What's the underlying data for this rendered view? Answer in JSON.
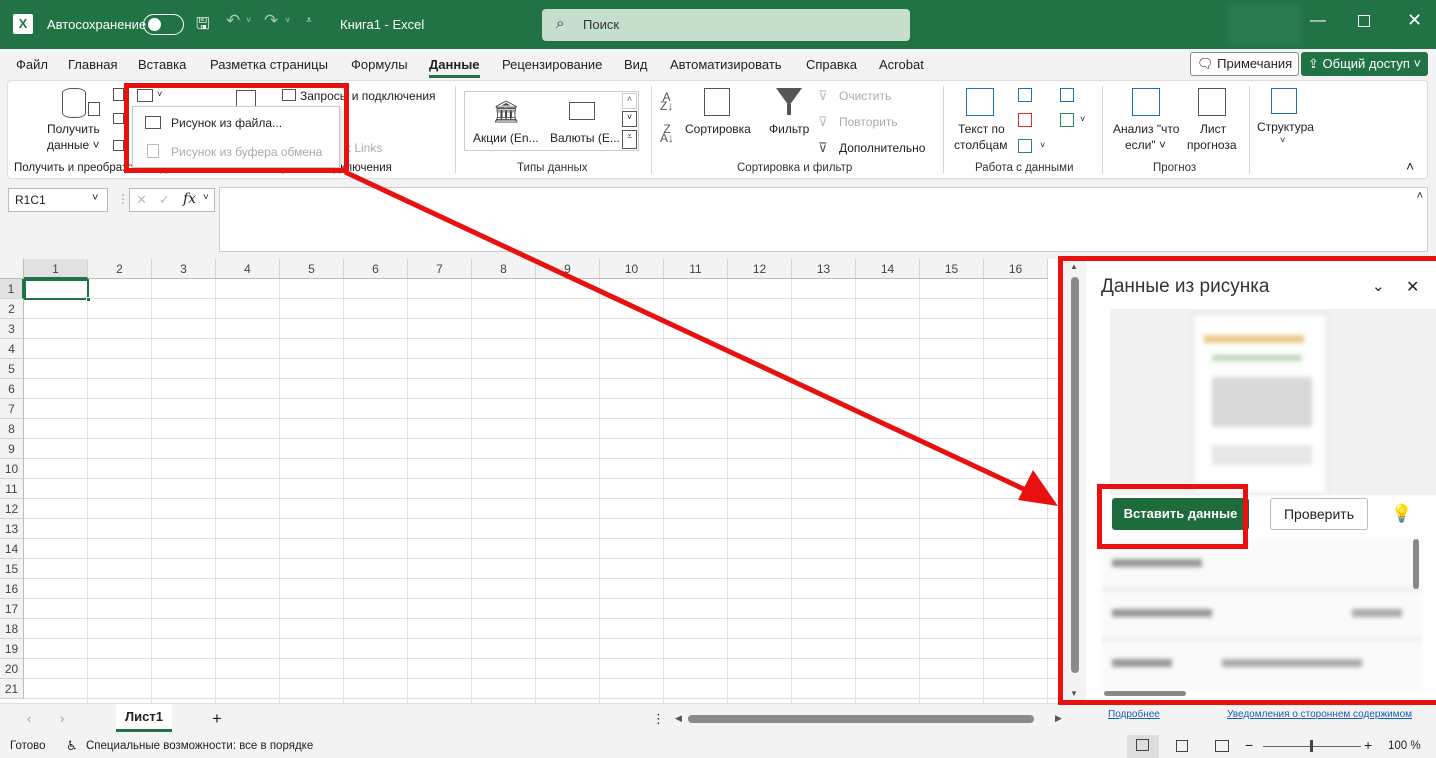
{
  "title_bar": {
    "autosave_label": "Автосохранение",
    "doc_title": "Книга1  -  Excel",
    "search_placeholder": "Поиск"
  },
  "tabs": [
    "Файл",
    "Главная",
    "Вставка",
    "Разметка страницы",
    "Формулы",
    "Данные",
    "Рецензирование",
    "Вид",
    "Автоматизировать",
    "Справка",
    "Acrobat"
  ],
  "active_tab": "Данные",
  "top_buttons": {
    "comments": "Примечания",
    "share": "Общий доступ"
  },
  "ribbon": {
    "get_data": [
      "Получить",
      "данные ˅"
    ],
    "queries": "Запросы и подключения",
    "links": "k Links",
    "stocks": "Акции (En...",
    "currencies": "Валюты (E...",
    "sort": "Сортировка",
    "filter": "Фильтр",
    "clear": "Очистить",
    "reapply": "Повторить",
    "advanced": "Дополнительно",
    "text_to_columns": [
      "Текст по",
      "столбцам"
    ],
    "whatif": [
      "Анализ \"что",
      "если\" ˅"
    ],
    "forecast": [
      "Лист",
      "прогноза"
    ],
    "outline": "Структура",
    "groups": {
      "get_transform": "Получить и преобразовать данные",
      "queries_conn": "Запросы и подключения",
      "data_types": "Типы данных",
      "sort_filter": "Сортировка и фильтр",
      "data_tools": "Работа с данными",
      "forecast": "Прогноз"
    }
  },
  "dropdown": {
    "from_file": "Рисунок из файла...",
    "from_clipboard": "Рисунок из буфера обмена"
  },
  "formula_bar": {
    "name_box": "R1C1",
    "fx": "fx"
  },
  "grid": {
    "columns": [
      "1",
      "2",
      "3",
      "4",
      "5",
      "6",
      "7",
      "8",
      "9",
      "10",
      "11",
      "12",
      "13",
      "14",
      "15",
      "16"
    ],
    "rows": [
      "1",
      "2",
      "3",
      "4",
      "5",
      "6",
      "7",
      "8",
      "9",
      "10",
      "11",
      "12",
      "13",
      "14",
      "15",
      "16",
      "17",
      "18",
      "19",
      "20",
      "21"
    ]
  },
  "pane": {
    "title": "Данные из рисунка",
    "insert_button": "Вставить данные",
    "review_button": "Проверить",
    "link_more": "Подробнее",
    "link_third_party": "Уведомления о стороннем содержимом"
  },
  "sheet": {
    "tab": "Лист1"
  },
  "status": {
    "ready": "Готово",
    "accessibility": "Специальные возможности: все в порядке",
    "zoom": "100 %"
  },
  "colors": {
    "brand": "#217346",
    "highlight": "#e8110f"
  }
}
